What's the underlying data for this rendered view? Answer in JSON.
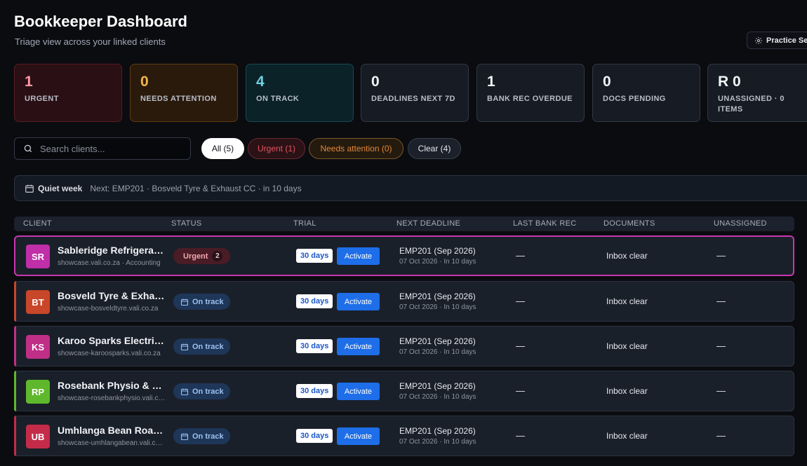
{
  "header": {
    "title": "Bookkeeper Dashboard",
    "subtitle": "Triage view across your linked clients",
    "practice_button": "Practice Settings"
  },
  "stats": [
    {
      "value": "1",
      "label": "URGENT"
    },
    {
      "value": "0",
      "label": "NEEDS ATTENTION"
    },
    {
      "value": "4",
      "label": "ON TRACK"
    },
    {
      "value": "0",
      "label": "DEADLINES NEXT 7D"
    },
    {
      "value": "1",
      "label": "BANK REC OVERDUE"
    },
    {
      "value": "0",
      "label": "DOCS PENDING"
    },
    {
      "value": "R 0",
      "label": "UNASSIGNED · 0 ITEMS"
    }
  ],
  "search": {
    "placeholder": "Search clients..."
  },
  "filters": {
    "all": "All (5)",
    "urgent": "Urgent (1)",
    "attention": "Needs attention (0)",
    "clear": "Clear (4)"
  },
  "quiet_banner": {
    "label": "Quiet week",
    "text": "Next: EMP201 · Bosveld Tyre & Exhaust CC · in 10 days"
  },
  "table": {
    "headers": [
      "CLIENT",
      "STATUS",
      "TRIAL",
      "NEXT DEADLINE",
      "LAST BANK REC",
      "DOCUMENTS",
      "UNASSIGNED"
    ],
    "rows": [
      {
        "initials": "SR",
        "name": "Sableridge Refrigeration",
        "sub": "showcase.vali.co.za · Accounting",
        "status": "Urgent",
        "status_count": "2",
        "trial": "30 days",
        "activate": "Activate",
        "deadline": "EMP201 (Sep 2026)",
        "deadline_sub": "07 Oct 2026 · In 10 days",
        "bank": "—",
        "docs": "Inbox clear",
        "unassigned": "—"
      },
      {
        "initials": "BT",
        "name": "Bosveld Tyre & Exhaust CC",
        "sub": "showcase-bosveldtyre.vali.co.za",
        "status": "On track",
        "trial": "30 days",
        "activate": "Activate",
        "deadline": "EMP201 (Sep 2026)",
        "deadline_sub": "07 Oct 2026 · In 10 days",
        "bank": "—",
        "docs": "Inbox clear",
        "unassigned": "—"
      },
      {
        "initials": "KS",
        "name": "Karoo Sparks Electrical",
        "sub": "showcase-karoosparks.vali.co.za",
        "status": "On track",
        "trial": "30 days",
        "activate": "Activate",
        "deadline": "EMP201 (Sep 2026)",
        "deadline_sub": "07 Oct 2026 · In 10 days",
        "bank": "—",
        "docs": "Inbox clear",
        "unassigned": "—"
      },
      {
        "initials": "RP",
        "name": "Rosebank Physio & Rehab",
        "sub": "showcase-rosebankphysio.vali.co.za",
        "status": "On track",
        "trial": "30 days",
        "activate": "Activate",
        "deadline": "EMP201 (Sep 2026)",
        "deadline_sub": "07 Oct 2026 · In 10 days",
        "bank": "—",
        "docs": "Inbox clear",
        "unassigned": "—"
      },
      {
        "initials": "UB",
        "name": "Umhlanga Bean Roasters",
        "sub": "showcase-umhlangabean.vali.co.za",
        "status": "On track",
        "trial": "30 days",
        "activate": "Activate",
        "deadline": "EMP201 (Sep 2026)",
        "deadline_sub": "07 Oct 2026 · In 10 days",
        "bank": "—",
        "docs": "Inbox clear",
        "unassigned": "—"
      }
    ]
  },
  "colors": {
    "avatar_sr": "#c02ea8",
    "avatar_bt": "#c8462a",
    "avatar_ks": "#c02f86",
    "avatar_rp": "#5fb82c",
    "avatar_ub": "#c42b49",
    "activate_blue": "#1d6ee8"
  }
}
